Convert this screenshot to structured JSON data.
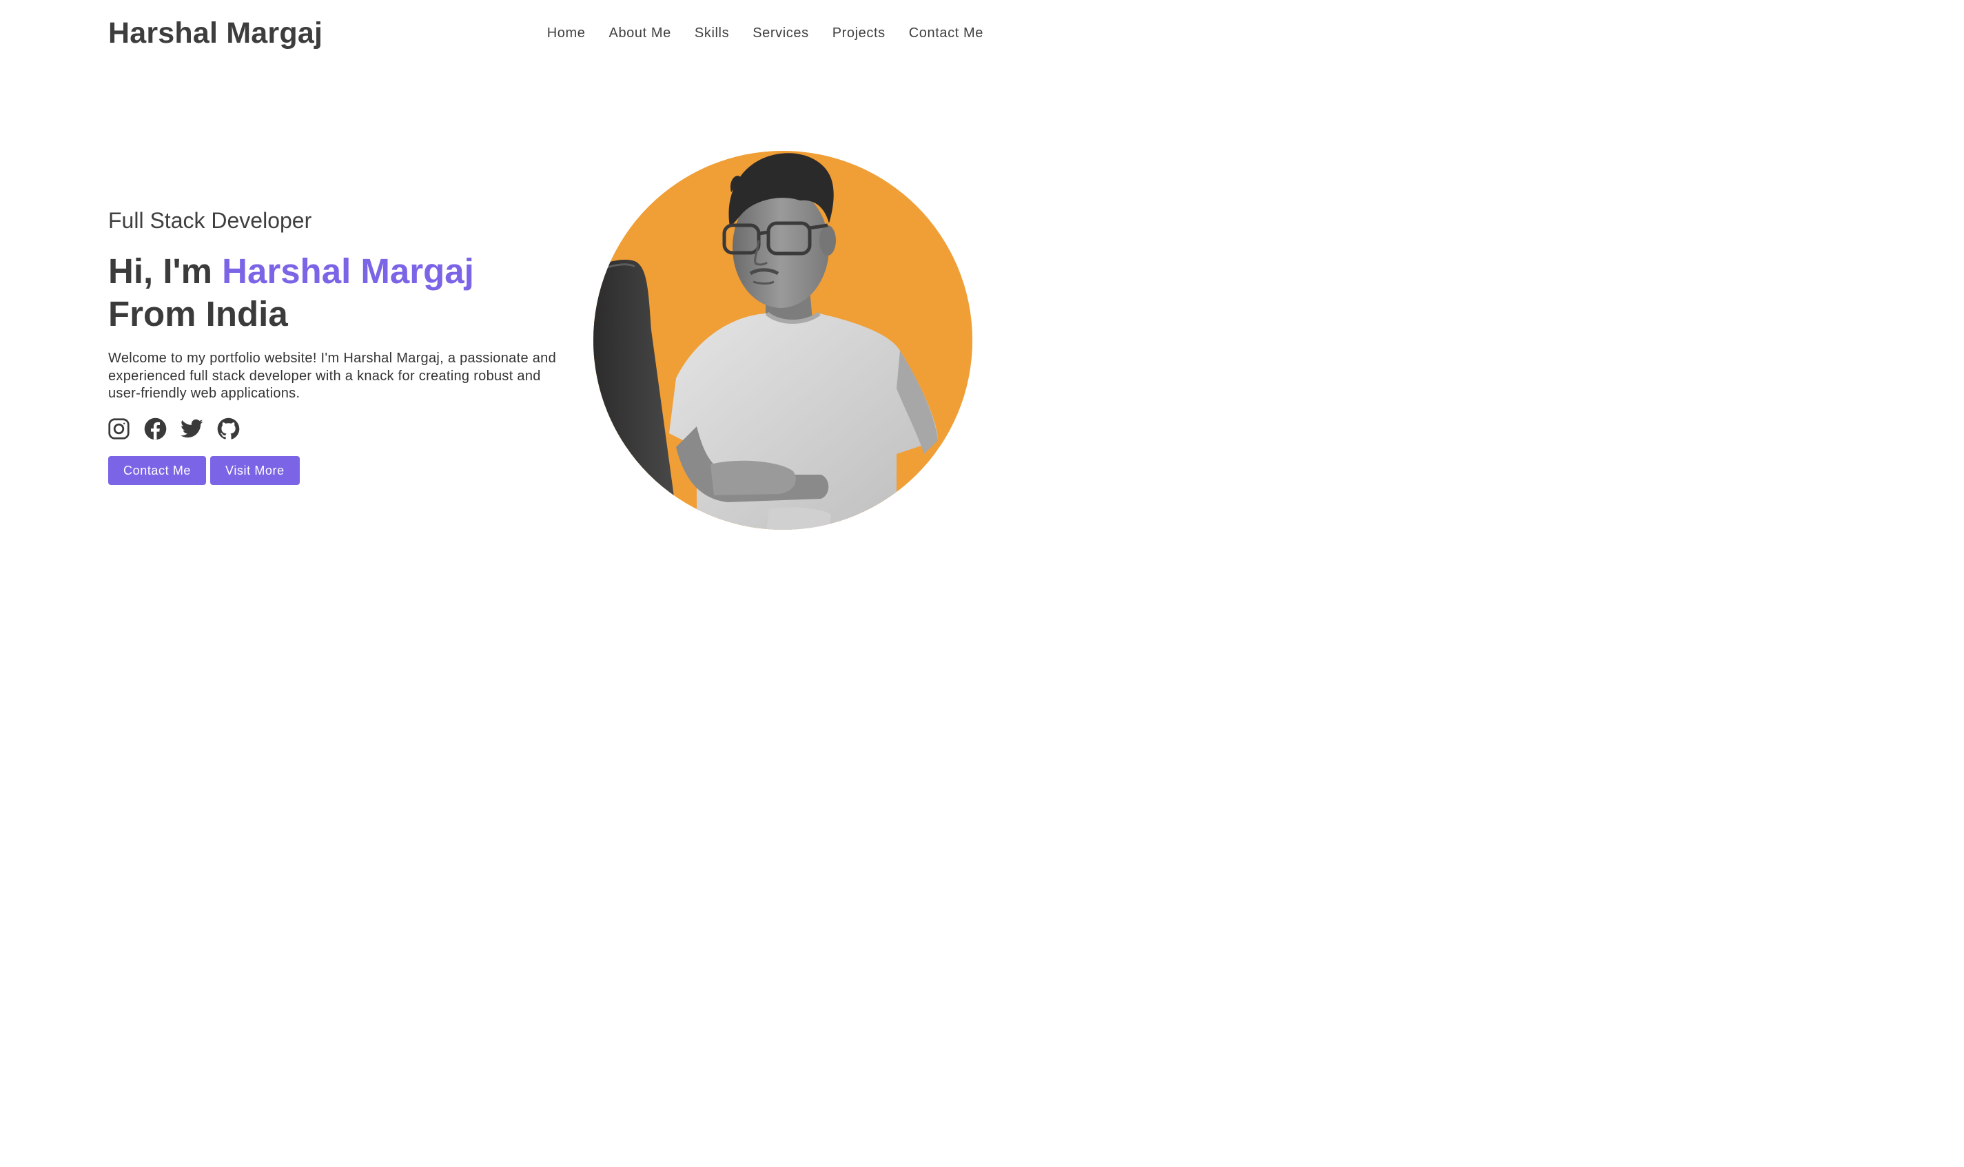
{
  "header": {
    "brand": "Harshal Margaj",
    "nav": [
      {
        "label": "Home"
      },
      {
        "label": "About Me"
      },
      {
        "label": "Skills"
      },
      {
        "label": "Services"
      },
      {
        "label": "Projects"
      },
      {
        "label": "Contact Me"
      }
    ]
  },
  "hero": {
    "role": "Full Stack Developer",
    "greeting": "Hi, I'm ",
    "name": "Harshal Margaj",
    "origin": "From India",
    "intro": "Welcome to my portfolio website! I'm Harshal Margaj, a passionate and experienced full stack developer with a knack for creating robust and user-friendly web applications.",
    "socials": [
      {
        "icon": "instagram-icon"
      },
      {
        "icon": "facebook-icon"
      },
      {
        "icon": "twitter-icon"
      },
      {
        "icon": "github-icon"
      }
    ],
    "buttons": {
      "contact": "Contact Me",
      "visit": "Visit More"
    }
  },
  "colors": {
    "accent": "#7b64e6",
    "text": "#3f3f3f",
    "portrait_background": "#f09e36"
  }
}
